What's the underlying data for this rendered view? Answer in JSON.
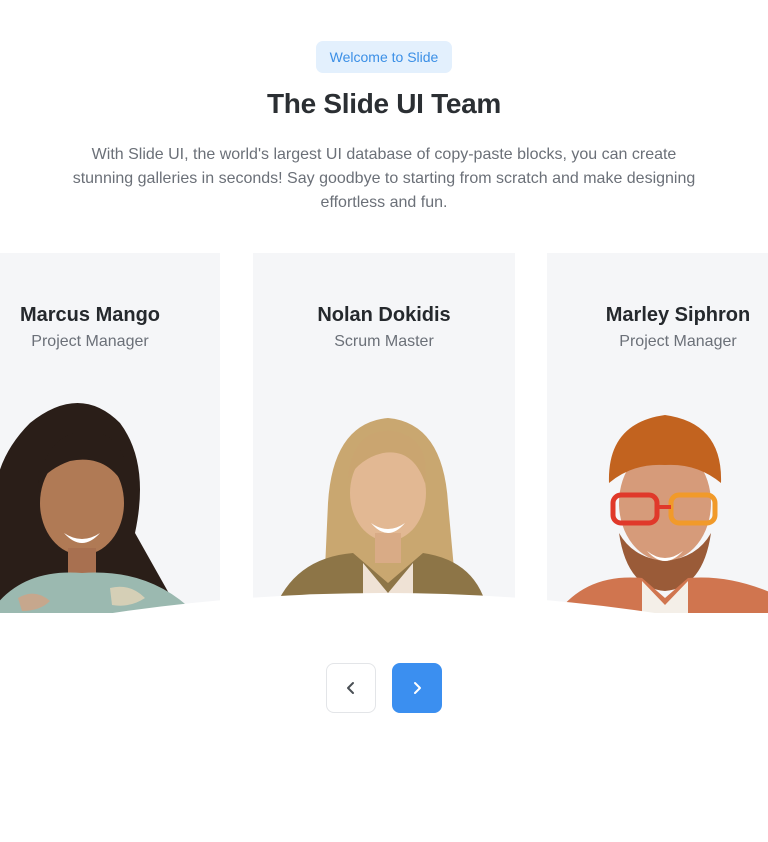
{
  "header": {
    "badge": "Welcome to Slide",
    "title": "The Slide UI Team",
    "subtitle": "With Slide UI, the world's largest UI database of copy-paste blocks, you can create stunning galleries in seconds! Say goodbye to starting from scratch and make designing effortless and fun."
  },
  "team": [
    {
      "name": "Marcus Mango",
      "role": "Project Manager"
    },
    {
      "name": "Nolan Dokidis",
      "role": "Scrum Master"
    },
    {
      "name": "Marley Siphron",
      "role": "Project Manager"
    }
  ],
  "navigation": {
    "prev_icon": "chevron-left-icon",
    "next_icon": "chevron-right-icon"
  },
  "colors": {
    "accent": "#3b8ff0",
    "badge_bg": "#e3f0fd",
    "card_bg": "#f5f6f8"
  }
}
